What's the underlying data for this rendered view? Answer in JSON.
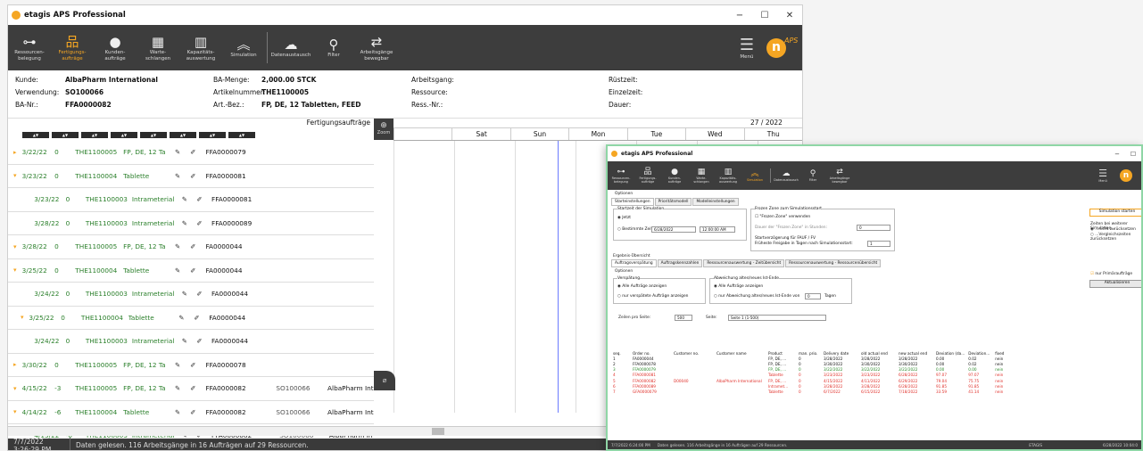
{
  "main": {
    "title": "etagis APS Professional",
    "controls": {
      "min": "−",
      "max": "☐",
      "close": "✕"
    },
    "ribbon": [
      {
        "icon": "⊶",
        "label": "Ressourcen-\nbelegung"
      },
      {
        "icon": "品",
        "label": "Fertigungs-\naufträge",
        "active": true
      },
      {
        "icon": "●",
        "label": "Kunden-\naufträge"
      },
      {
        "icon": "▦",
        "label": "Warte-\nschlangen"
      },
      {
        "icon": "▥",
        "label": "Kapazitäts-\nauswertung"
      },
      {
        "icon": "︽",
        "label": "Simulation"
      },
      {
        "icon": "☁",
        "label": "Datenaustausch"
      },
      {
        "icon": "⚲",
        "label": "Filter"
      },
      {
        "icon": "⇄",
        "label": "Arbeitsgänge\nbewegbar"
      }
    ],
    "menu_label": "Menü",
    "logo": {
      "letter": "n",
      "text": "APS",
      "sub": "gis"
    },
    "info": {
      "kunde_l": "Kunde:",
      "kunde_v": "AlbaPharm International",
      "verw_l": "Verwendung:",
      "verw_v": "SO100066",
      "ba_l": "BA-Nr.:",
      "ba_v": "FFA0000082",
      "menge_l": "BA-Menge:",
      "menge_v": "2,000.00 STCK",
      "art_l": "Artikelnummer:",
      "art_v": "THE1100005",
      "bez_l": "Art.-Bez.:",
      "bez_v": "FP, DE, 12 Tabletten, FEED",
      "ag_l": "Arbeitsgang:",
      "res_l": "Ressource:",
      "rn_l": "Ress.-Nr.:",
      "rz_l": "Rüstzeit:",
      "ez_l": "Einzelzeit:",
      "dauer_l": "Dauer:"
    },
    "grid_title": "Fertigungsaufträge",
    "sort_arrows": "▲▼",
    "zoom": "Zoom",
    "week": "27 / 2022",
    "days": [
      "Sat",
      "Sun",
      "Mon",
      "Tue",
      "Wed",
      "Thu"
    ],
    "rows": [
      {
        "tg": "▸",
        "d": "3/22/22",
        "q": "0",
        "a": "THE1100005",
        "n": "FP, DE, 12 Ta",
        "o": "FFA0000079",
        "o2": "",
        "c": ""
      },
      {
        "tg": "▾",
        "d": "3/23/22",
        "q": "0",
        "a": "THE1100004",
        "n": "Tablette",
        "o": "FFA0000081",
        "o2": "",
        "c": ""
      },
      {
        "tg": "",
        "d": "3/23/22",
        "q": "0",
        "a": "THE1100003",
        "n": "Intrameterial",
        "o": "FFA0000081",
        "o2": "",
        "c": ""
      },
      {
        "tg": "",
        "d": "3/28/22",
        "q": "0",
        "a": "THE1100003",
        "n": "Intrameterial",
        "o": "FFA0000089",
        "o2": "",
        "c": ""
      },
      {
        "tg": "▾",
        "d": "3/28/22",
        "q": "0",
        "a": "THE1100005",
        "n": "FP, DE, 12 Ta",
        "o": "FA0000044",
        "o2": "",
        "c": ""
      },
      {
        "tg": "▾",
        "d": "3/25/22",
        "q": "0",
        "a": "THE1100004",
        "n": "Tablette",
        "o": "FA0000044",
        "o2": "",
        "c": ""
      },
      {
        "tg": "",
        "d": "3/24/22",
        "q": "0",
        "a": "THE1100003",
        "n": "Intrameterial",
        "o": "FA0000044",
        "o2": "",
        "c": ""
      },
      {
        "tg": "▾",
        "d": "3/25/22",
        "q": "0",
        "a": "THE1100004",
        "n": "Tablette",
        "o": "FA0000044",
        "o2": "",
        "c": ""
      },
      {
        "tg": "",
        "d": "3/24/22",
        "q": "0",
        "a": "THE1100003",
        "n": "Intrameterial",
        "o": "FA0000044",
        "o2": "",
        "c": ""
      },
      {
        "tg": "▸",
        "d": "3/30/22",
        "q": "0",
        "a": "THE1100005",
        "n": "FP, DE, 12 Ta",
        "o": "FFA0000078",
        "o2": "",
        "c": ""
      },
      {
        "tg": "▾",
        "d": "4/15/22",
        "q": "-3",
        "a": "THE1100005",
        "n": "FP, DE, 12 Ta",
        "o": "FFA0000082",
        "o2": "SO100066",
        "c": "AlbaPharm Inter"
      },
      {
        "tg": "▾",
        "d": "4/14/22",
        "q": "-6",
        "a": "THE1100004",
        "n": "Tablette",
        "o": "FFA0000082",
        "o2": "SO100066",
        "c": "AlbaPharm Inte"
      },
      {
        "tg": "",
        "d": "4/13/22",
        "q": "-6",
        "a": "THE1100003",
        "n": "Intrameterial",
        "o": "FFA0000082",
        "o2": "SO100066",
        "c": "AlbaPharm In"
      }
    ],
    "status_time": "7/7/2022 3:26:29 PM",
    "status_msg": "Daten gelesen. 116 Arbeitsgänge in 16 Aufträgen auf 29 Ressourcen."
  },
  "sim": {
    "title": "etagis APS Professional",
    "options": "Optionen",
    "tabs": [
      "Starteinstellungen",
      "Prioritätsmodell",
      "Modelleinstellungen"
    ],
    "startzeit": "Startzeit der Simulation",
    "jetzt": "Jetzt",
    "bestimmte": "Bestimmte Zeit:",
    "date": "6/28/2022",
    "time": "12:00:00 AM",
    "frozen_title": "Frozen Zone zum Simulationsstart",
    "frozen_cb": "\"Frozen Zone\" verwenden",
    "frozen_dauer": "Dauer der \"Frozen Zone\" in Stunden:",
    "frozen_val": "0",
    "startverz": "Startverzögerung für FAUF / FV",
    "frueheste": "Früheste Freigabe in Tagen nach Simulationsstart:",
    "frueheste_val": "1",
    "start_btn": "Simulation starten",
    "zeiten": "Zeiten bei weiterer Simulation...",
    "zeiten1": "...nicht zurücksetzen",
    "zeiten2": "...Vergleichszeiten zurücksetzen",
    "ergebnis": "Ergebnis-Übersicht",
    "rtabs": [
      "Auftragsverspätung",
      "Auftragskennzahlen",
      "Ressourcenauswertung - Zeitübersicht",
      "Ressourcenauswertung - Ressourcenübersicht"
    ],
    "opt2": "Optionen",
    "versp": "Verspätung",
    "alle": "Alle Aufträge anzeigen",
    "nur_v": "nur verspätete Aufträge anzeigen",
    "abw": "Abweichung altes/neues Ist-Ende",
    "alle2": "Alle Aufträge anzeigen",
    "nur_a": "nur Abweichung altes/neues Ist-Ende von",
    "abw_val": "0",
    "tage": "Tagen",
    "prim": "nur Primäraufträge",
    "akt": "Aktualisieren",
    "zps": "Zeilen pro Seite:",
    "zps_val": "500",
    "seite": "Seite:",
    "seite_val": "Seite 1 (1-500)",
    "cols": [
      "seq.",
      "Order no.",
      "Customer no.",
      "Customer name",
      "Product",
      "man. prio.",
      "Delivery date",
      "old actual end",
      "new actual end",
      "Deviation (da...",
      "Deviation...",
      "fixed"
    ],
    "trows": [
      {
        "cls": "",
        "v": [
          "1",
          "FA0000044",
          "",
          "",
          "FP, DE, ...",
          "0",
          "3/28/2022",
          "3/28/2022",
          "3/28/2022",
          "0.00",
          "0.02",
          "nein"
        ]
      },
      {
        "cls": "",
        "v": [
          "2",
          "FFA0000078",
          "",
          "",
          "FP, DE, ...",
          "0",
          "3/30/2022",
          "3/30/2022",
          "3/30/2022",
          "0.00",
          "0.02",
          "nein"
        ]
      },
      {
        "cls": "g",
        "v": [
          "3",
          "FFA0000079",
          "",
          "",
          "FP, DE, ...",
          "0",
          "3/22/2022",
          "3/22/2022",
          "3/22/2022",
          "0.00",
          "0.00",
          "nein"
        ]
      },
      {
        "cls": "r",
        "v": [
          "4",
          "FFA0000081",
          "",
          "",
          "Tablette",
          "0",
          "3/23/2022",
          "3/23/2022",
          "6/28/2022",
          "97.07",
          "97.07",
          "nein"
        ]
      },
      {
        "cls": "r",
        "v": [
          "5",
          "FFA0000082",
          "D00040",
          "AlbaPharm International",
          "FP, DE, ...",
          "0",
          "4/15/2022",
          "4/11/2022",
          "6/29/2022",
          "79.04",
          "75.75",
          "nein"
        ]
      },
      {
        "cls": "r",
        "v": [
          "6",
          "FFA0000089",
          "",
          "",
          "Intramet...",
          "0",
          "3/28/2022",
          "3/28/2022",
          "6/28/2022",
          "91.85",
          "91.85",
          "nein"
        ]
      },
      {
        "cls": "r",
        "v": [
          "7",
          "GFA0000079",
          "",
          "",
          "Tablette",
          "0",
          "6/7/2022",
          "6/15/2022",
          "7/18/2022",
          "33.59",
          "41.14",
          "nein"
        ]
      }
    ],
    "status_time": "7/7/2022 6:24:00 PM",
    "status_msg": "Daten gelesen. 116 Arbeitsgänge in 16 Aufträgen auf 29 Ressourcen.",
    "status_mid": "ETAGIS",
    "status_right": "6/28/2022 10:04:0"
  }
}
